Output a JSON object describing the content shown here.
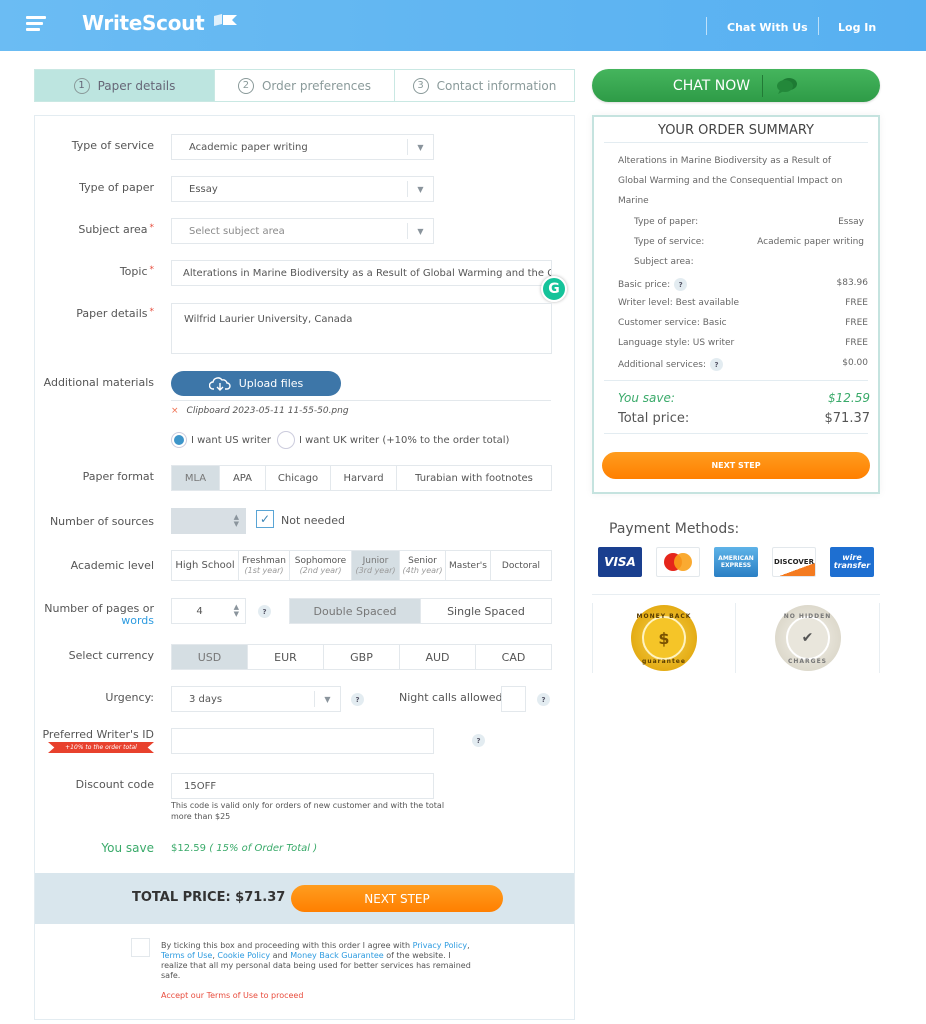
{
  "header": {
    "logo": "WriteScout",
    "nav": [
      "Chat With Us",
      "Log In"
    ]
  },
  "steps": [
    {
      "num": "1",
      "label": "Paper details",
      "active": true
    },
    {
      "num": "2",
      "label": "Order preferences",
      "active": false
    },
    {
      "num": "3",
      "label": "Contact information",
      "active": false
    }
  ],
  "form": {
    "type_of_service": {
      "label": "Type of service",
      "value": "Academic paper writing"
    },
    "type_of_paper": {
      "label": "Type of paper",
      "value": "Essay"
    },
    "subject_area": {
      "label": "Subject area",
      "placeholder": "Select subject area",
      "required_mark": "*"
    },
    "topic": {
      "label": "Topic",
      "value": "Alterations in Marine Biodiversity as a Result of Global Warming and the Consequential Impact on Marine",
      "required_mark": "*"
    },
    "paper_details": {
      "label": "Paper details",
      "value": "Wilfrid Laurier University, Canada",
      "required_mark": "*"
    },
    "additional_materials": {
      "label": "Additional materials",
      "upload_label": "Upload files",
      "files": [
        {
          "name": "Clipboard 2023-05-11 11-55-50.png",
          "remove_glyph": "×"
        }
      ]
    },
    "writer_origin": {
      "options": [
        {
          "label": "I want US writer",
          "selected": true
        },
        {
          "label": "I want UK writer (+10% to the order total)",
          "selected": false
        }
      ]
    },
    "paper_format": {
      "label": "Paper format",
      "options": [
        "MLA",
        "APA",
        "Chicago",
        "Harvard",
        "Turabian with footnotes"
      ],
      "selected": "MLA"
    },
    "number_of_sources": {
      "label": "Number of sources",
      "value": "",
      "not_needed_label": "Not needed",
      "not_needed_checked": true
    },
    "academic_level": {
      "label": "Academic level",
      "options": [
        {
          "label": "High School",
          "sub": ""
        },
        {
          "label": "Freshman",
          "sub": "(1st year)"
        },
        {
          "label": "Sophomore",
          "sub": "(2nd year)"
        },
        {
          "label": "Junior",
          "sub": "(3rd year)"
        },
        {
          "label": "Senior",
          "sub": "(4th year)"
        },
        {
          "label": "Master's",
          "sub": ""
        },
        {
          "label": "Doctoral",
          "sub": ""
        }
      ],
      "selected": "Junior"
    },
    "pages": {
      "label": "Number of pages or",
      "label_link": "words",
      "value": "4",
      "help": "?"
    },
    "spacing": {
      "options": [
        "Double Spaced",
        "Single Spaced"
      ],
      "selected": "Double Spaced"
    },
    "currency": {
      "label": "Select currency",
      "options": [
        "USD",
        "EUR",
        "GBP",
        "AUD",
        "CAD"
      ],
      "selected": "USD"
    },
    "urgency": {
      "label": "Urgency:",
      "value": "3 days",
      "help": "?"
    },
    "night_calls": {
      "label": "Night calls allowed",
      "checked": false,
      "help": "?"
    },
    "preferred_writer": {
      "label": "Preferred Writer's ID",
      "ribbon": "+10% to the order total",
      "value": "",
      "help": "?"
    },
    "discount": {
      "label": "Discount code",
      "value": "15OFF",
      "hint": "This code is valid only for orders of new customer and with the total more than $25"
    },
    "you_save": {
      "label": "You save",
      "amount": "$12.59",
      "note": "( 15% of Order Total )"
    },
    "total": {
      "label": "TOTAL PRICE: $71.37",
      "next_label": "NEXT STEP"
    },
    "agreement": {
      "text_1": "By ticking this box and proceeding with this order I agree with ",
      "link_privacy": "Privacy Policy",
      "sep_1": ", ",
      "link_terms": "Terms of Use",
      "sep_2": ", ",
      "link_cookie": "Cookie Policy",
      "text_2": " and ",
      "link_money": "Money Back Guarantee",
      "text_3": " of the website. I realize that all my personal data being used for better services has remained safe.",
      "warning": "Accept our Terms of Use to proceed",
      "checked": false
    }
  },
  "sidebar": {
    "chat_now": "CHAT NOW",
    "summary": {
      "title": "YOUR ORDER SUMMARY",
      "topic": "Alterations in Marine Biodiversity as a Result of Global Warming and the Consequential Impact on Marine",
      "details": [
        {
          "label": "Type of paper:",
          "value": "Essay"
        },
        {
          "label": "Type of service:",
          "value": "Academic paper writing"
        },
        {
          "label": "Subject area:",
          "value": ""
        }
      ],
      "prices": [
        {
          "label": "Basic price:",
          "value": "$83.96",
          "help": true
        },
        {
          "label": "Writer level: Best available",
          "value": "FREE",
          "help": false
        },
        {
          "label": "Customer service: Basic",
          "value": "FREE",
          "help": false
        },
        {
          "label": "Language style: US writer",
          "value": "FREE",
          "help": false
        },
        {
          "label": "Additional services:",
          "value": "$0.00",
          "help": true
        }
      ],
      "you_save_label": "You save:",
      "you_save_value": "$12.59",
      "total_label": "Total price:",
      "total_value": "$71.37",
      "next_label": "NEXT STEP"
    },
    "payment": {
      "title": "Payment Methods:",
      "cards": [
        "VISA",
        "MasterCard",
        "AMERICAN EXPRESS",
        "DISCOVER",
        "wire transfer"
      ]
    },
    "badges": [
      {
        "top": "MONEY BACK",
        "bottom": "guarantee",
        "center": "$"
      },
      {
        "top": "NO HIDDEN",
        "bottom": "CHARGES",
        "center": "✔"
      }
    ]
  }
}
